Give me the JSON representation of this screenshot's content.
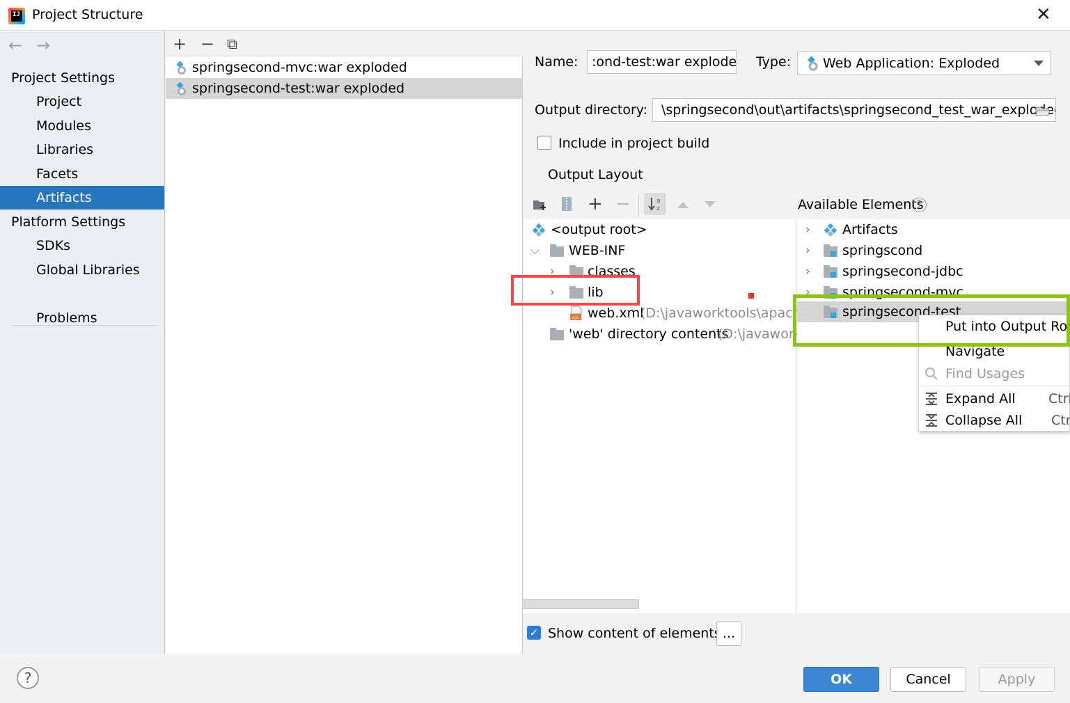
{
  "window": {
    "title": "Project Structure",
    "close": "✕"
  },
  "nav": {
    "back": "←",
    "forward": "→",
    "project_settings": "Project Settings",
    "project_items": [
      "Project",
      "Modules",
      "Libraries",
      "Facets",
      "Artifacts"
    ],
    "selected": "Artifacts",
    "platform_settings": "Platform Settings",
    "platform_items": [
      "SDKs",
      "Global Libraries"
    ],
    "problems": "Problems"
  },
  "artifacts_toolbar": {
    "add": "+",
    "remove": "−",
    "copy": "⧉"
  },
  "artifacts": [
    {
      "label": "springsecond-mvc:war exploded",
      "selected": false
    },
    {
      "label": "springsecond-test:war exploded",
      "selected": true
    }
  ],
  "form": {
    "name_label": "Name:",
    "name_value": ":ond-test:war exploded",
    "type_label": "Type:",
    "type_value": "Web Application: Exploded",
    "output_dir_label": "Output directory:",
    "output_dir_value": "\\springsecond\\out\\artifacts\\springsecond_test_war_exploded",
    "include_label": "Include in project build",
    "include_checked": false
  },
  "output_layout": {
    "tab_label": "Output Layout",
    "available_label": "Available Elements",
    "help": "?",
    "tree": [
      {
        "label": "<output root>"
      },
      {
        "label": "WEB-INF"
      },
      {
        "label": "classes"
      },
      {
        "label": "lib"
      },
      {
        "label": "web.xml",
        "path": "(D:\\javaworktools\\apache"
      },
      {
        "label": "'web' directory contents",
        "path": "(D:\\javawork"
      }
    ],
    "available": [
      {
        "label": "Artifacts"
      },
      {
        "label": "springscond"
      },
      {
        "label": "springsecond-jdbc"
      },
      {
        "label": "springsecond-mvc"
      },
      {
        "label": "springsecond-test"
      }
    ],
    "show_content_label": "Show content of elements",
    "show_content_checked": true,
    "more_button": "..."
  },
  "context_menu": {
    "items": [
      {
        "label": "Put into Output Root",
        "shortcut": ""
      },
      {
        "label": "Navigate",
        "shortcut": ""
      },
      {
        "label": "Find Usages",
        "shortcut": "",
        "disabled": true
      },
      {
        "label": "Expand All",
        "shortcut": "Ctrl"
      },
      {
        "label": "Collapse All",
        "shortcut": "Ctr"
      }
    ]
  },
  "footer": {
    "help": "?",
    "ok": "OK",
    "cancel": "Cancel",
    "apply": "Apply"
  },
  "colors": {
    "accent": "#2675bf",
    "highlight_red": "#f24a4a",
    "highlight_green": "#8cc414"
  }
}
